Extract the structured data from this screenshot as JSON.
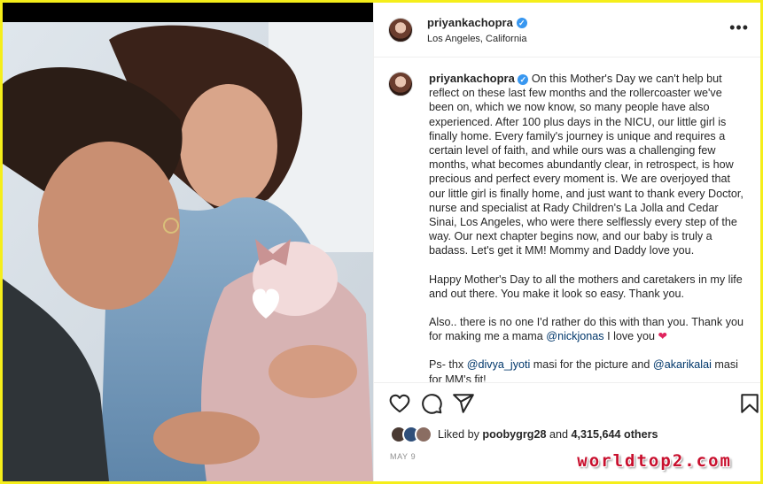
{
  "header": {
    "username": "priyankachopra",
    "location": "Los Angeles, California",
    "more_label": "•••",
    "verified_mark": "✓"
  },
  "caption": {
    "username": "priyankachopra",
    "paragraph1": "On this Mother's Day we can't help but reflect on these last few months and the rollercoaster we've been on, which we now know, so many people have also experienced. After 100 plus days in the NICU, our little girl is finally home. Every family's journey is unique and requires a certain level of faith, and while ours was a challenging few months, what becomes abundantly clear, in retrospect, is how precious and perfect every moment is. We are overjoyed that our little girl is finally home, and just want to thank every Doctor, nurse and specialist at Rady Children's La Jolla and Cedar Sinai, Los Angeles, who were there selflessly every step of the way. Our next chapter begins now, and our baby is truly a badass. Let's get it MM! Mommy and Daddy love you.",
    "paragraph2": "Happy Mother's Day to all the mothers and caretakers in my life and out there. You make it look so easy. Thank you.",
    "p3_before": "Also.. there is no one I'd rather do this with than you. Thank you for making me a mama ",
    "p3_mention": "@nickjonas",
    "p3_after": " I love you ",
    "p3_heart": "❤",
    "p4_before": "Ps- thx ",
    "p4_mention1": "@divya_jyoti",
    "p4_middle": " masi for the picture and ",
    "p4_mention2": "@akarikalai",
    "p4_after": " masi for MM's fit!"
  },
  "likes": {
    "prefix": "Liked by ",
    "user": "poobygrg28",
    "middle": " and ",
    "count": "4,315,644 others"
  },
  "date": "MAY 9",
  "watermark": "worldtop2.com",
  "icons": [
    "heart-icon",
    "comment-icon",
    "share-icon",
    "bookmark-icon",
    "more-icon",
    "verified-icon"
  ],
  "colors": {
    "border": "#f5ee1a",
    "verified": "#3897f0",
    "mention": "#00376b",
    "heart": "#e0245e",
    "watermark": "#c8102e"
  }
}
